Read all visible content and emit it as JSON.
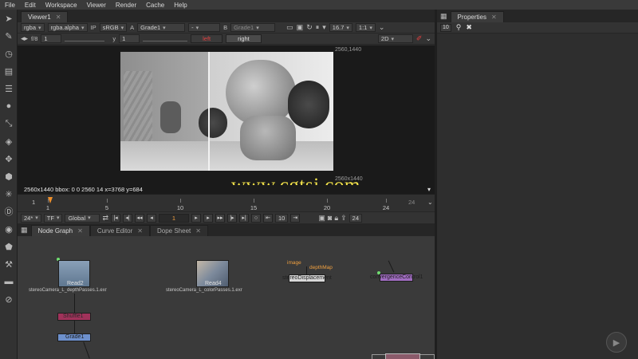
{
  "menu": [
    "File",
    "Edit",
    "Workspace",
    "Viewer",
    "Render",
    "Cache",
    "Help"
  ],
  "viewer": {
    "tab_label": "Viewer1",
    "channels": "rgba",
    "alpha": "rgba.alpha",
    "colorspace": "sRGB",
    "input_a_label": "A",
    "input_a": "Grade1",
    "operation": "-",
    "input_b_label": "B",
    "input_b": "Grade1",
    "zoom": "16.7",
    "ratio": "1:1",
    "fstop": "f/8",
    "gain": "1",
    "gamma_label": "y",
    "gamma": "1",
    "left_label": "left",
    "right_label": "right",
    "view_mode": "2D",
    "corner_top_right": "2560,1440",
    "corner_bottom_right": "2560x1440",
    "info": "2560x1440   bbox: 0 0 2560 14  x=3768 y=684",
    "watermark": "www.cgtsj.com"
  },
  "timeline": {
    "start": "1",
    "end_marker": "24",
    "ticks": [
      "1",
      "5",
      "10",
      "15",
      "20",
      "24"
    ],
    "fps": "24*",
    "mode": "TF",
    "scope": "Global",
    "current_frame": "1",
    "step": "10",
    "end_frame": "24"
  },
  "node_tabs": [
    {
      "label": "Node Graph"
    },
    {
      "label": "Curve Editor"
    },
    {
      "label": "Dope Sheet"
    }
  ],
  "nodes": {
    "read2": {
      "label": "Read2",
      "file": "stereoCamera_L_depthPasses.1.exr"
    },
    "read4": {
      "label": "Read4",
      "file": "stereoCamera_L_colorPasses.1.exr"
    },
    "stereo": {
      "label": "stereoDisplacement",
      "input_image": "image",
      "input_depth": "depthMap"
    },
    "convergence": {
      "label": "convergenceControl1"
    },
    "shuffle": {
      "label": "Shuffle1"
    },
    "grade": {
      "label": "Grade1"
    }
  },
  "properties": {
    "tab_label": "Properties",
    "count": "10"
  },
  "colors": {
    "accent": "#f0a040",
    "read_node": "#5f7790",
    "shuffle_node": "#a0325a",
    "grade_node": "#6d90cc",
    "stereo_node": "#d8d8d8",
    "convergence_node": "#a06cc0"
  },
  "toolbar_icons": [
    "pointer-icon",
    "paint-icon",
    "clock-icon",
    "channel-icon",
    "layers-icon",
    "sphere-icon",
    "transform-icon",
    "stack-icon",
    "move-icon",
    "cube-icon",
    "particle-icon",
    "deep-icon",
    "view-icon",
    "meta-icon",
    "tools-icon",
    "toolsets-icon",
    "other-icon"
  ]
}
